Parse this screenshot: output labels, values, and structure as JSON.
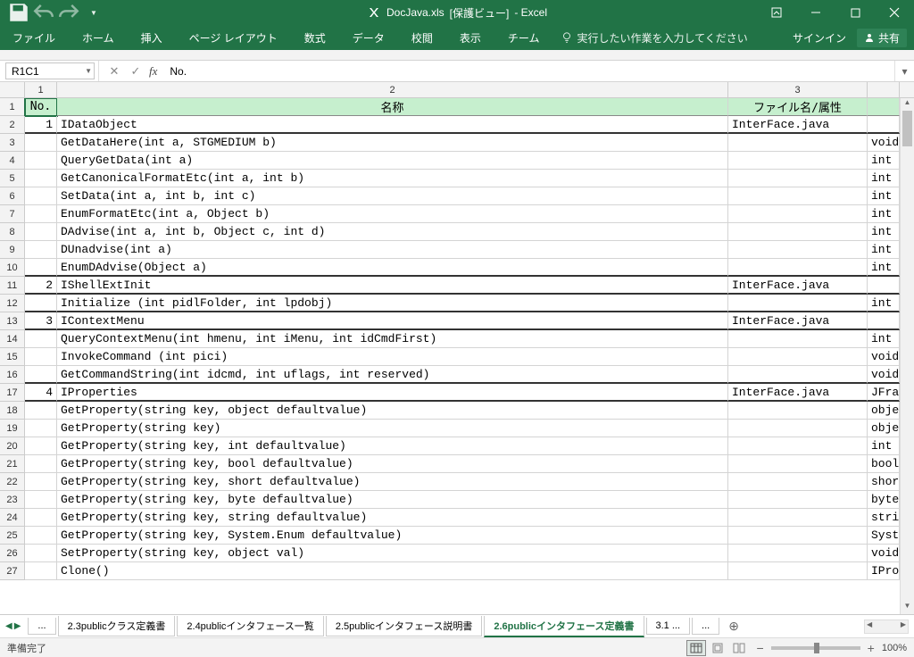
{
  "title": {
    "filename": "DocJava.xls",
    "mode": "[保護ビュー]",
    "app": "- Excel"
  },
  "tabs": {
    "file": "ファイル",
    "home": "ホーム",
    "insert": "挿入",
    "pagelayout": "ページ レイアウト",
    "formulas": "数式",
    "data": "データ",
    "review": "校閲",
    "view": "表示",
    "team": "チーム",
    "tellme": "実行したい作業を入力してください",
    "signin": "サインイン",
    "share": "共有"
  },
  "namebox": "R1C1",
  "formula": "No.",
  "col_headers": [
    "1",
    "2",
    "3",
    ""
  ],
  "table_headers": {
    "no": "No.",
    "name": "名称",
    "file": "ファイル名/属性"
  },
  "rows": [
    {
      "r": 2,
      "no": "1",
      "name": "IDataObject",
      "file": "InterFace.java",
      "ret": "",
      "thick": true
    },
    {
      "r": 3,
      "no": "",
      "name": "GetDataHere(int a, STGMEDIUM b)",
      "file": "",
      "ret": "void"
    },
    {
      "r": 4,
      "no": "",
      "name": "QueryGetData(int a)",
      "file": "",
      "ret": "int"
    },
    {
      "r": 5,
      "no": "",
      "name": "GetCanonicalFormatEtc(int a, int b)",
      "file": "",
      "ret": "int"
    },
    {
      "r": 6,
      "no": "",
      "name": "SetData(int a, int b, int c)",
      "file": "",
      "ret": "int"
    },
    {
      "r": 7,
      "no": "",
      "name": "EnumFormatEtc(int a, Object b)",
      "file": "",
      "ret": "int"
    },
    {
      "r": 8,
      "no": "",
      "name": "DAdvise(int a, int b, Object c, int d)",
      "file": "",
      "ret": "int"
    },
    {
      "r": 9,
      "no": "",
      "name": "DUnadvise(int a)",
      "file": "",
      "ret": "int"
    },
    {
      "r": 10,
      "no": "",
      "name": "EnumDAdvise(Object a)",
      "file": "",
      "ret": "int",
      "thick": true
    },
    {
      "r": 11,
      "no": "2",
      "name": "IShellExtInit",
      "file": "InterFace.java",
      "ret": "",
      "thick": true
    },
    {
      "r": 12,
      "no": "",
      "name": "Initialize (int pidlFolder, int lpdobj)",
      "file": "",
      "ret": "int",
      "thick": true
    },
    {
      "r": 13,
      "no": "3",
      "name": "IContextMenu",
      "file": "InterFace.java",
      "ret": "",
      "thick": true
    },
    {
      "r": 14,
      "no": "",
      "name": "QueryContextMenu(int hmenu, int iMenu, int idCmdFirst)",
      "file": "",
      "ret": "int"
    },
    {
      "r": 15,
      "no": "",
      "name": "InvokeCommand (int pici)",
      "file": "",
      "ret": "void"
    },
    {
      "r": 16,
      "no": "",
      "name": "GetCommandString(int idcmd, int uflags, int reserved)",
      "file": "",
      "ret": "void",
      "thick": true
    },
    {
      "r": 17,
      "no": "4",
      "name": "IProperties",
      "file": "InterFace.java",
      "ret": "JFra",
      "thick": true
    },
    {
      "r": 18,
      "no": "",
      "name": "GetProperty(string key, object defaultvalue)",
      "file": "",
      "ret": "obje"
    },
    {
      "r": 19,
      "no": "",
      "name": "GetProperty(string key)",
      "file": "",
      "ret": "obje"
    },
    {
      "r": 20,
      "no": "",
      "name": "GetProperty(string key, int defaultvalue)",
      "file": "",
      "ret": "int"
    },
    {
      "r": 21,
      "no": "",
      "name": "GetProperty(string key, bool defaultvalue)",
      "file": "",
      "ret": "bool"
    },
    {
      "r": 22,
      "no": "",
      "name": "GetProperty(string key, short defaultvalue)",
      "file": "",
      "ret": "shor"
    },
    {
      "r": 23,
      "no": "",
      "name": "GetProperty(string key, byte defaultvalue)",
      "file": "",
      "ret": "byte"
    },
    {
      "r": 24,
      "no": "",
      "name": "GetProperty(string key, string defaultvalue)",
      "file": "",
      "ret": "stri"
    },
    {
      "r": 25,
      "no": "",
      "name": "GetProperty(string key, System.Enum defaultvalue)",
      "file": "",
      "ret": "Syst"
    },
    {
      "r": 26,
      "no": "",
      "name": "SetProperty(string key, object val)",
      "file": "",
      "ret": "void"
    },
    {
      "r": 27,
      "no": "",
      "name": "Clone()",
      "file": "",
      "ret": "IPro"
    }
  ],
  "sheets": {
    "overflow_left": "...",
    "s1": "2.3publicクラス定義書",
    "s2": "2.4publicインタフェース一覧",
    "s3": "2.5publicインタフェース説明書",
    "s4": "2.6publicインタフェース定義書",
    "s5": "3.1 ...",
    "overflow_right": "..."
  },
  "status": {
    "ready": "準備完了",
    "zoom": "100%"
  }
}
